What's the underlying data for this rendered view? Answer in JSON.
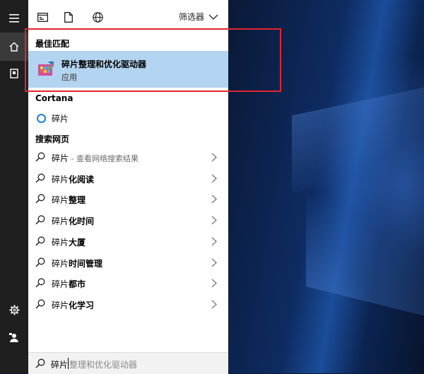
{
  "toolbar": {
    "filter_label": "筛选器",
    "icons": [
      "apps-icon",
      "document-icon",
      "web-icon",
      "chevron-down-icon"
    ]
  },
  "best_match": {
    "heading": "最佳匹配",
    "app_name": "碎片整理和优化驱动器",
    "app_type": "应用"
  },
  "cortana": {
    "heading": "Cortana",
    "item": "碎片"
  },
  "web": {
    "heading": "搜索网页",
    "items": [
      {
        "prefix": "碎片",
        "bold": "",
        "hint": " - 查看网络搜索结果"
      },
      {
        "prefix": "碎片",
        "bold": "化阅读",
        "hint": ""
      },
      {
        "prefix": "碎片",
        "bold": "整理",
        "hint": ""
      },
      {
        "prefix": "碎片",
        "bold": "化时间",
        "hint": ""
      },
      {
        "prefix": "碎片",
        "bold": "大厦",
        "hint": ""
      },
      {
        "prefix": "碎片",
        "bold": "时间管理",
        "hint": ""
      },
      {
        "prefix": "碎片",
        "bold": "都市",
        "hint": ""
      },
      {
        "prefix": "碎片",
        "bold": "化学习",
        "hint": ""
      }
    ]
  },
  "search": {
    "typed": "碎片",
    "suggestion": "整理和优化驱动器"
  },
  "rail": {
    "icons": [
      "hamburger-menu-icon",
      "home-icon",
      "notebook-icon",
      "settings-gear-icon",
      "feedback-icon"
    ]
  },
  "colors": {
    "highlight_frame": "#e0262e",
    "selected_bg": "#b3d4f0",
    "rail_bg": "#1f1f1f",
    "cortana_accent": "#1e7fd8"
  }
}
